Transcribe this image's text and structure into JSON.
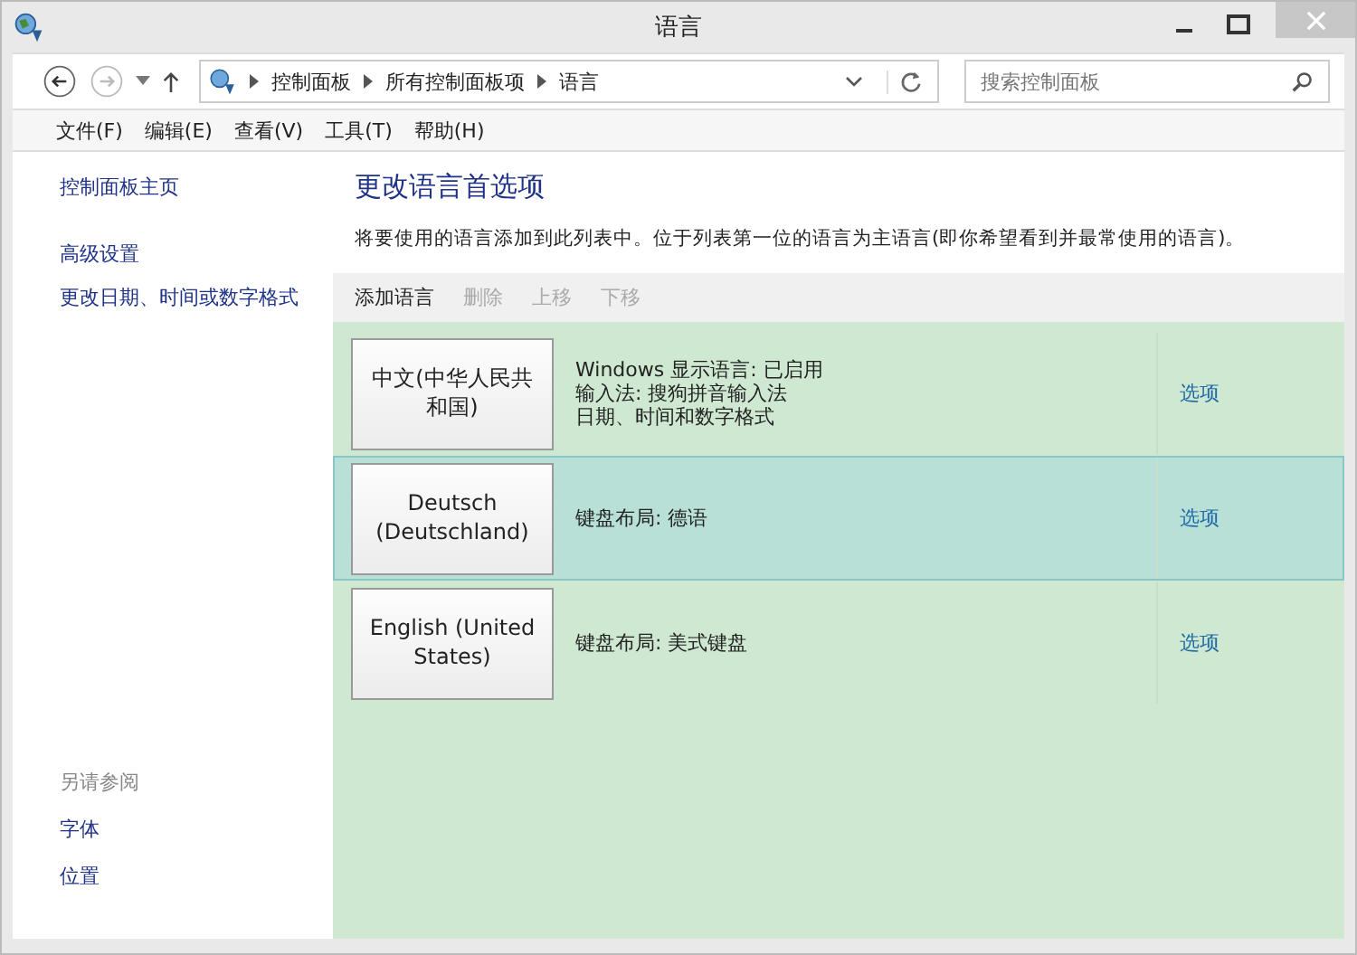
{
  "window": {
    "title": "语言"
  },
  "address_bar": {
    "breadcrumbs": [
      "控制面板",
      "所有控制面板项",
      "语言"
    ]
  },
  "search": {
    "placeholder": "搜索控制面板"
  },
  "menu": [
    "文件(F)",
    "编辑(E)",
    "查看(V)",
    "工具(T)",
    "帮助(H)"
  ],
  "sidebar": {
    "links": [
      "控制面板主页",
      "高级设置",
      "更改日期、时间或数字格式"
    ],
    "see_also": {
      "heading": "另请参阅",
      "links": [
        "字体",
        "位置"
      ]
    }
  },
  "main": {
    "heading": "更改语言首选项",
    "description": "将要使用的语言添加到此列表中。位于列表第一位的语言为主语言(即你希望看到并最常使用的语言)。",
    "toolbar": [
      {
        "label": "添加语言",
        "disabled": false
      },
      {
        "label": "删除",
        "disabled": true
      },
      {
        "label": "上移",
        "disabled": true
      },
      {
        "label": "下移",
        "disabled": true
      }
    ],
    "languages": [
      {
        "name": "中文(中华人民共和国)",
        "details": [
          "Windows 显示语言: 已启用",
          "输入法: 搜狗拼音输入法",
          "日期、时间和数字格式"
        ],
        "options": "选项",
        "selected": false
      },
      {
        "name": "Deutsch (Deutschland)",
        "details": [
          "键盘布局: 德语"
        ],
        "options": "选项",
        "selected": true
      },
      {
        "name": "English (United States)",
        "details": [
          "键盘布局: 美式键盘"
        ],
        "options": "选项",
        "selected": false
      }
    ]
  }
}
